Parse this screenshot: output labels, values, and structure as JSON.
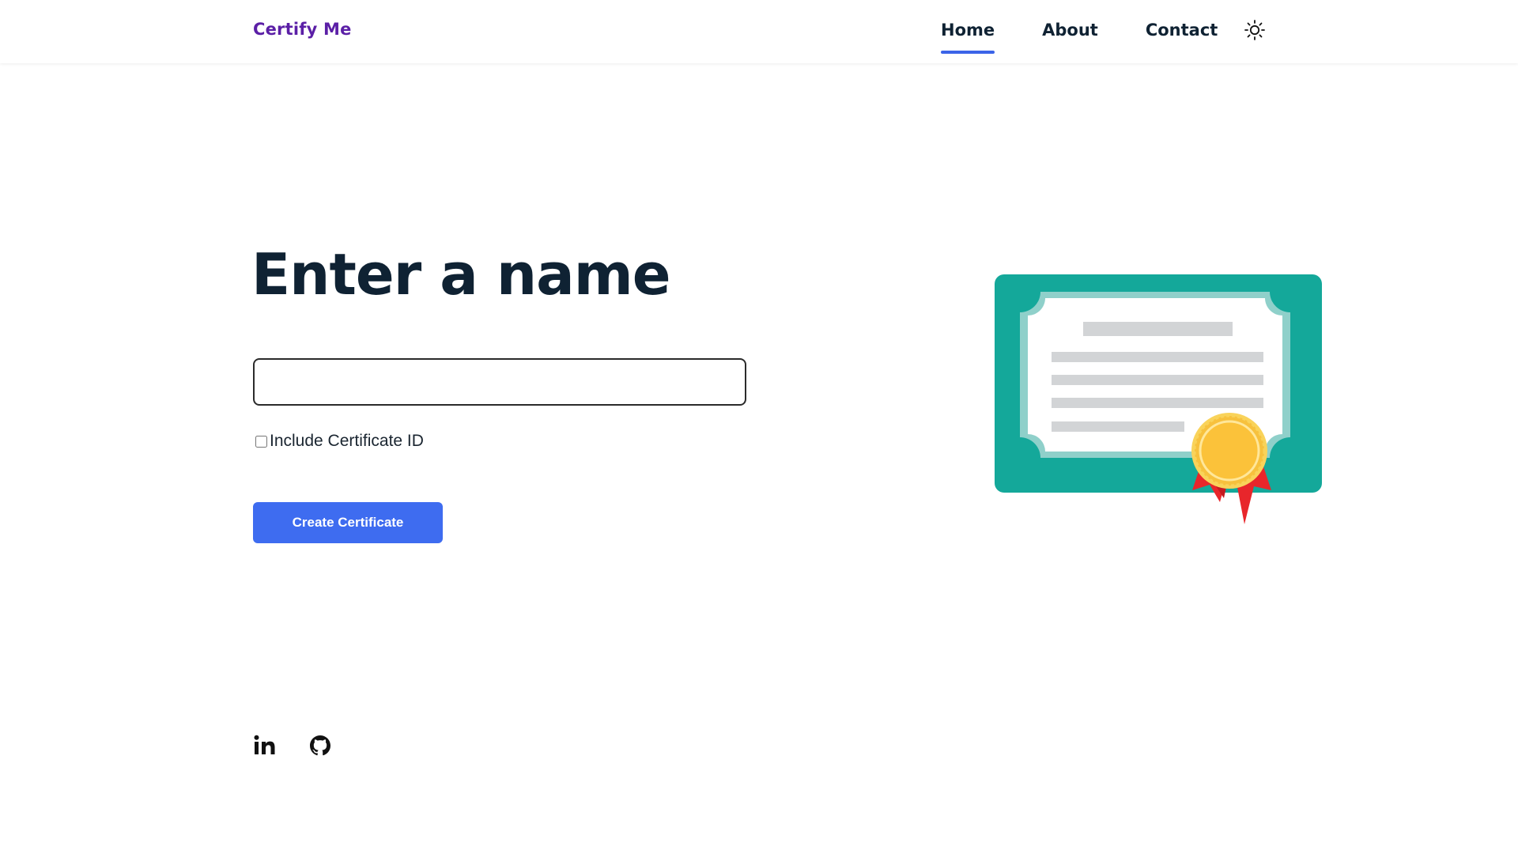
{
  "header": {
    "brand": "Certify Me",
    "nav": [
      {
        "label": "Home",
        "active": true
      },
      {
        "label": "About",
        "active": false
      },
      {
        "label": "Contact",
        "active": false
      }
    ],
    "theme_icon": "sun-icon"
  },
  "main": {
    "title": "Enter a name",
    "name_input": {
      "value": "",
      "placeholder": ""
    },
    "checkbox": {
      "label": "Include Certificate ID",
      "checked": false
    },
    "create_button": "Create Certificate",
    "illustration_icon": "certificate-icon"
  },
  "footer": {
    "social_icons": [
      "linkedin-icon",
      "github-icon"
    ]
  },
  "colors": {
    "brand": "#5b1fa6",
    "accent": "#3e6cf0",
    "nav_underline": "#3b64e8",
    "heading": "#0f2233",
    "certificate_frame": "#14a89a",
    "ribbon": "#e8262b",
    "medal": "#f7c13d"
  }
}
